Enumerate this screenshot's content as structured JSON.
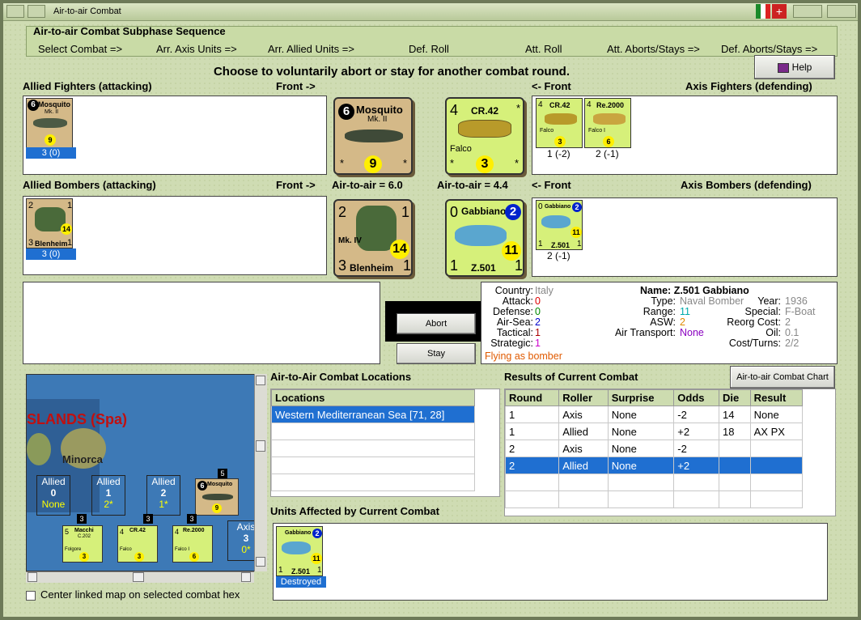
{
  "window": {
    "title": "Air-to-air Combat"
  },
  "sequence": {
    "header": "Air-to-air Combat Subphase Sequence",
    "steps": [
      "Select Combat =>",
      "Arr. Axis Units =>",
      "Arr. Allied Units =>",
      "Def. Roll",
      "Att. Roll",
      "Att. Aborts/Stays =>",
      "Def. Aborts/Stays =>"
    ]
  },
  "prompt": "Choose to voluntarily abort or stay for another combat round.",
  "help_label": "Help",
  "labels": {
    "allied_fighters": "Allied Fighters (attacking)",
    "front_right": "Front ->",
    "front_left": "<- Front",
    "axis_fighters": "Axis Fighters (defending)",
    "allied_bombers": "Allied Bombers (attacking)",
    "air_to_air_allied": "Air-to-air = 6.0",
    "air_to_air_axis": "Air-to-air = 4.4",
    "axis_bombers": "Axis Bombers (defending)"
  },
  "units": {
    "mosquito": {
      "name": "Mosquito",
      "model": "Mk. II",
      "top": "6",
      "val": "9",
      "status": "3 (0)"
    },
    "cr42": {
      "name": "CR.42",
      "sub": "Falco",
      "top": "4",
      "val": "3",
      "status": "1 (-2)"
    },
    "re2000": {
      "name": "Re.2000",
      "sub": "Falco I",
      "top": "4",
      "val": "6",
      "status": "2 (-1)"
    },
    "blenheim": {
      "name": "Blenheim",
      "model": "Mk. IV",
      "tl": "2",
      "tr": "1",
      "bl": "3",
      "br": "1",
      "val": "14",
      "status": "3 (0)"
    },
    "z501": {
      "name": "Gabbiano",
      "model": "Z.501",
      "tl": "0",
      "badge": "2",
      "bl": "1",
      "br": "1",
      "val": "11",
      "status": "2 (-1)"
    }
  },
  "buttons": {
    "abort": "Abort",
    "stay": "Stay",
    "chart": "Air-to-air Combat Chart"
  },
  "info": {
    "country_label": "Country:",
    "country": "Italy",
    "attack_label": "Attack:",
    "attack": "0",
    "defense_label": "Defense:",
    "defense": "0",
    "airsea_label": "Air-Sea:",
    "airsea": "2",
    "tactical_label": "Tactical:",
    "tactical": "1",
    "strategic_label": "Strategic:",
    "strategic": "1",
    "flying": "Flying as bomber",
    "name_label": "Name:",
    "name": "Z.501 Gabbiano",
    "type_label": "Type:",
    "type": "Naval Bomber",
    "year_label": "Year:",
    "year": "1936",
    "range_label": "Range:",
    "range": "11",
    "special_label": "Special:",
    "special": "F-Boat",
    "asw_label": "ASW:",
    "asw": "2",
    "reorg_label": "Reorg Cost:",
    "reorg": "2",
    "airtransport_label": "Air Transport:",
    "airtransport": "None",
    "oil_label": "Oil:",
    "oil": "0.1",
    "costturns_label": "Cost/Turns:",
    "costturns": "2/2"
  },
  "locations": {
    "title": "Air-to-Air Combat Locations",
    "header": "Locations",
    "rows": [
      "Western Mediterranean Sea [71, 28]"
    ]
  },
  "results": {
    "title": "Results of Current Combat",
    "headers": [
      "Round",
      "Roller",
      "Surprise",
      "Odds",
      "Die",
      "Result"
    ],
    "rows": [
      [
        "1",
        "Axis",
        "None",
        "-2",
        "14",
        "None"
      ],
      [
        "1",
        "Allied",
        "None",
        "+2",
        "18",
        "AX PX"
      ],
      [
        "2",
        "Axis",
        "None",
        "-2",
        "",
        ""
      ],
      [
        "2",
        "Allied",
        "None",
        "+2",
        "",
        ""
      ]
    ]
  },
  "affected": {
    "title": "Units Affected by Current Combat",
    "status": "Destroyed"
  },
  "map": {
    "region": "SLANDS (Spa)",
    "island": "Minorca",
    "boxes": [
      {
        "label": "Allied",
        "num": "0",
        "sub": "None"
      },
      {
        "label": "Allied",
        "num": "1",
        "sub": "2*"
      },
      {
        "label": "Allied",
        "num": "2",
        "sub": "1*"
      },
      {
        "label": "Axis",
        "num": "3",
        "sub": "0*"
      }
    ],
    "stack_counts": [
      "5",
      "3",
      "3",
      "3"
    ],
    "counters": [
      {
        "name": "Macchi",
        "model": "C.202",
        "sub": "Folgore",
        "top": "5",
        "val": "3"
      },
      {
        "name": "CR.42",
        "sub": "Falco",
        "top": "4",
        "val": "3"
      },
      {
        "name": "Re.2000",
        "sub": "Falco I",
        "top": "4",
        "val": "6"
      }
    ]
  },
  "checkbox_label": "Center linked map on selected combat hex"
}
